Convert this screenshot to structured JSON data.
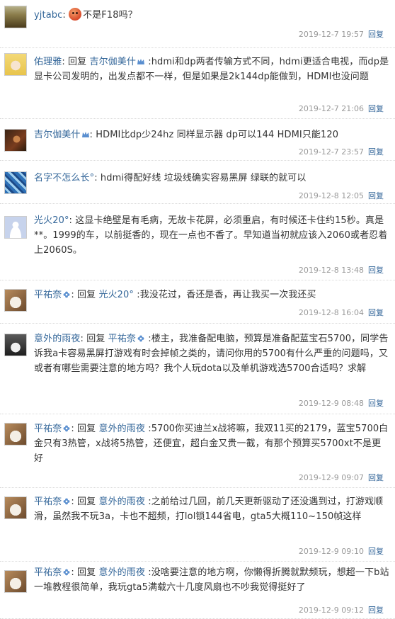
{
  "colors": {
    "username": "#336699",
    "meta": "#999999",
    "text": "#333333"
  },
  "reply_label": "回复",
  "comments": [
    {
      "user": "yjtabc",
      "reply_to": "",
      "text": "不是F18吗？",
      "emoji": "face-emoji",
      "time": "2019-12-7 19:57",
      "action": "回复",
      "avatar": "landscape-avatar"
    },
    {
      "user": "佑理雅",
      "reply_to": "吉尔伽美什",
      "text": ":hdmi和dp两者传输方式不同，hdmi更适合电视，而dp是显卡公司发明的，出发点都不一样，但是如果是2k144dp能做到，HDMI也没问题",
      "time": "2019-12-7 21:06",
      "action": "回复",
      "avatar": "anime-girl-avatar"
    },
    {
      "user": "吉尔伽美什",
      "reply_to": "",
      "text": "HDMI比dp少24hz 同样显示器 dp可以144 HDMI只能120",
      "time": "2019-12-7 23:57",
      "action": "回复",
      "avatar": "dark-character-avatar"
    },
    {
      "user": "名字不怎么长°",
      "reply_to": "",
      "text": "hdmi得配好线 垃圾线确实容易黑屏 绿联的就可以",
      "time": "2019-12-8 12:05",
      "action": "回复",
      "avatar": "blue-pattern-avatar"
    },
    {
      "user": "光火20°",
      "reply_to": "",
      "text": "这显卡绝壁是有毛病，无故卡花屏，必须重启，有时候还卡住约15秒。真是**。1999的车，以前挺香的，现在一点也不香了。早知道当初就应该入2060或者忍着上2060S。",
      "time": "2019-12-8 13:48",
      "action": "回复",
      "avatar": "default-user-avatar"
    },
    {
      "user": "平祐奈",
      "reply_to": "光火20°",
      "text": ":我没花过，香还是香，再让我买一次我还买",
      "time": "2019-12-8 16:04",
      "action": "回复",
      "avatar": "cat-avatar"
    },
    {
      "user": "意外的雨夜",
      "reply_to": "平祐奈",
      "text": ":楼主，我准备配电脑，预算是准备配蓝宝石5700，同学告诉我a卡容易黑屏打游戏有时会掉帧之类的，请问你用的5700有什么严重的问题吗，又或者有哪些需要注意的地方吗？我个人玩dota以及单机游戏选5700合适吗？求解",
      "time": "2019-12-9 08:48",
      "action": "回复",
      "avatar": "husky-avatar"
    },
    {
      "user": "平祐奈",
      "reply_to": "意外的雨夜",
      "text": ":5700你买迪兰x战将嘛，我双11买的2179，蓝宝5700白金只有3热管，x战将5热管，还便宜，超白金又贵一截，有那个预算买5700xt不是更好",
      "time": "2019-12-9 09:07",
      "action": "回复",
      "avatar": "cat-avatar"
    },
    {
      "user": "平祐奈",
      "reply_to": "意外的雨夜",
      "text": ":之前给过几回，前几天更新驱动了还没遇到过，打游戏顺滑，虽然我不玩3a，卡也不超频，打lol锁144省电，gta5大概110~150帧这样",
      "time": "2019-12-9 09:10",
      "action": "回复",
      "avatar": "cat-avatar"
    },
    {
      "user": "平祐奈",
      "reply_to": "意外的雨夜",
      "text": ":没啥要注意的地方啊，你懒得折腾就默频玩，想超一下b站一堆教程很简单，我玩gta5满载六十几度风扇也不吵我觉得挺好了",
      "time": "2019-12-9 09:12",
      "action": "回复",
      "avatar": "cat-avatar"
    }
  ]
}
